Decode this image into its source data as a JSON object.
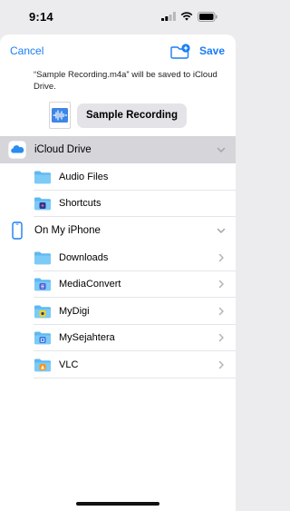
{
  "status_bar": {
    "time": "9:14"
  },
  "nav": {
    "cancel_label": "Cancel",
    "save_label": "Save"
  },
  "save_message": "“Sample Recording.m4a” will be saved to iCloud Drive.",
  "file": {
    "name": "Sample Recording"
  },
  "colors": {
    "accent": "#1a7df5",
    "folder": "#6ec4f5",
    "selected_row": "#d5d5da"
  },
  "locations": [
    {
      "label": "iCloud Drive",
      "icon": "icloud-icon",
      "selected": true,
      "items": [
        {
          "label": "Audio Files",
          "icon": "folder-icon"
        },
        {
          "label": "Shortcuts",
          "icon": "shortcuts-folder-icon"
        }
      ]
    },
    {
      "label": "On My iPhone",
      "icon": "iphone-icon",
      "selected": false,
      "items": [
        {
          "label": "Downloads",
          "icon": "downloads-folder-icon"
        },
        {
          "label": "MediaConvert",
          "icon": "mediaconvert-folder-icon"
        },
        {
          "label": "MyDigi",
          "icon": "mydigi-folder-icon"
        },
        {
          "label": "MySejahtera",
          "icon": "mysejahtera-folder-icon"
        },
        {
          "label": "VLC",
          "icon": "vlc-folder-icon"
        }
      ]
    }
  ]
}
